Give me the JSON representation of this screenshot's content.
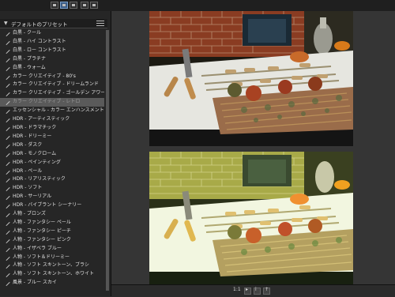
{
  "toolbar": {
    "buttons": [
      {
        "icon": "grid-small-icon",
        "selected": false
      },
      {
        "icon": "single-view-icon",
        "selected": true
      },
      {
        "icon": "grid-large-icon",
        "selected": false
      },
      {
        "icon": "compare-icon",
        "selected": false
      },
      {
        "icon": "view-menu-icon",
        "selected": false
      }
    ]
  },
  "panel": {
    "title": "デフォルトのプリセット",
    "presets": [
      "白黒 - クール",
      "白黒 - ハイ コントラスト",
      "白黒 - ロー コントラスト",
      "白黒 - プラチナ",
      "白黒 - ウォーム",
      "カラー クリエイティブ - 80's",
      "カラー クリエイティブ - ドリームランド",
      "カラー クリエイティブ - ゴールデン アワーベ...",
      "カラー クリエイティブ - レトロ",
      "エッセンシャル - カラー エンハンスメント",
      "HDR - アーティスティック",
      "HDR - ドラマチック",
      "HDR - ドリーミー",
      "HDR - ダスク",
      "HDR - モノクローム",
      "HDR - ペインティング",
      "HDR - ペール",
      "HDR - リアリスティック",
      "HDR - ソフト",
      "HDR - サーリアル",
      "HDR - バイブラント シーナリー",
      "人物 - ブロンズ",
      "人物 - ファンタシー ペール",
      "人物 - ファンタシー ピーチ",
      "人物 - ファンタシー ピンク",
      "人物 - イザベラ ブルー",
      "人物 - ソフト＆ドリーミー",
      "人物 - ソフト スキントーン、ブラシ",
      "人物 - ソフト スキントーン、ホワイト",
      "風景 - ブルー スカイ"
    ],
    "selected_index": 8
  },
  "bottombar": {
    "counter": "1:1",
    "buttons": [
      "fit-icon",
      "info-icon",
      "export-icon"
    ]
  },
  "colors": {
    "accent": "#3d5d86",
    "selection": "#5a5a5a"
  }
}
